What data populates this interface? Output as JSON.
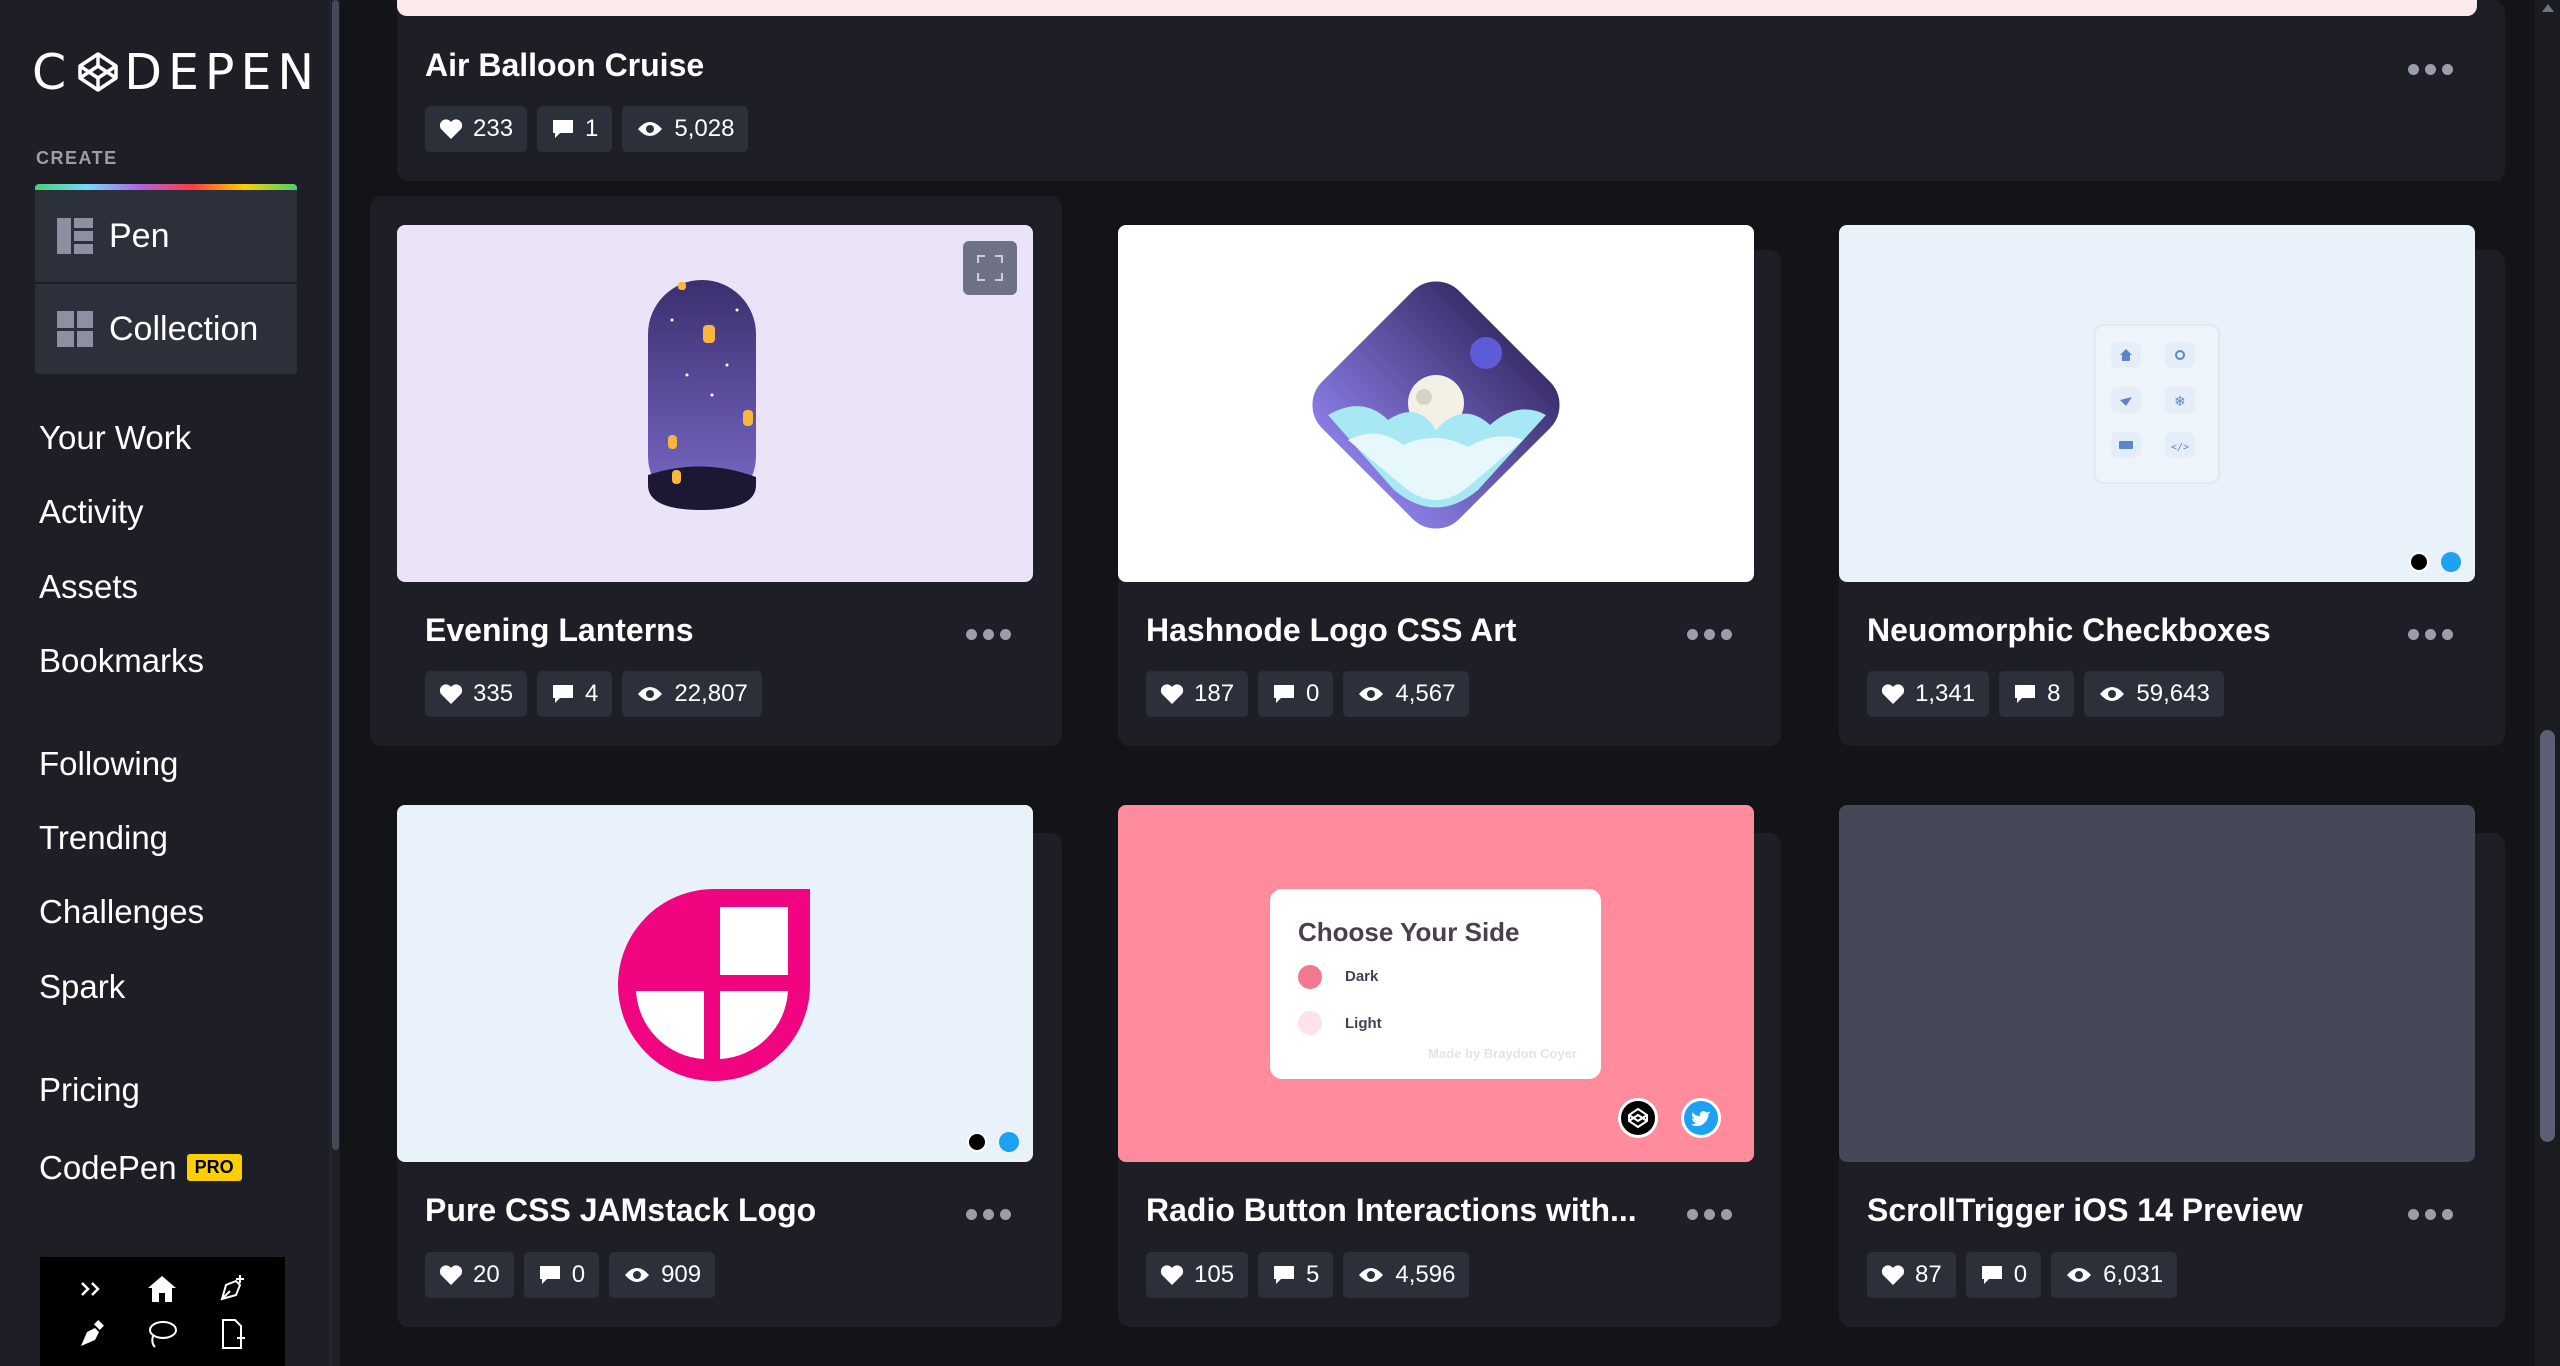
{
  "brand": {
    "logo_text_left": "C",
    "logo_text_right": "DEPEN"
  },
  "sidebar": {
    "create_label": "CREATE",
    "create_items": [
      {
        "label": "Pen",
        "icon": "pen-layout-icon"
      },
      {
        "label": "Collection",
        "icon": "collection-grid-icon"
      }
    ],
    "nav": [
      {
        "label": "Your Work"
      },
      {
        "label": "Activity"
      },
      {
        "label": "Assets"
      },
      {
        "label": "Bookmarks"
      },
      {
        "label": "Following"
      },
      {
        "label": "Trending"
      },
      {
        "label": "Challenges"
      },
      {
        "label": "Spark"
      },
      {
        "label": "Pricing"
      },
      {
        "label": "CodePen",
        "badge": "PRO"
      }
    ],
    "tools": [
      "collapse-icon",
      "home-icon",
      "new-pen-icon",
      "pen-tool-icon",
      "lasso-icon",
      "new-file-icon"
    ]
  },
  "cards": [
    {
      "title": "Air Balloon Cruise",
      "likes": "233",
      "comments": "1",
      "views": "5,028"
    },
    {
      "title": "Evening Lanterns",
      "likes": "335",
      "comments": "4",
      "views": "22,807"
    },
    {
      "title": "Hashnode Logo CSS Art",
      "likes": "187",
      "comments": "0",
      "views": "4,567"
    },
    {
      "title": "Neuomorphic Checkboxes",
      "likes": "1,341",
      "comments": "8",
      "views": "59,643"
    },
    {
      "title": "Pure CSS JAMstack Logo",
      "likes": "20",
      "comments": "0",
      "views": "909"
    },
    {
      "title": "Radio Button Interactions with...",
      "likes": "105",
      "comments": "5",
      "views": "4,596"
    },
    {
      "title": "ScrollTrigger iOS 14 Preview",
      "likes": "87",
      "comments": "0",
      "views": "6,031"
    }
  ],
  "radio_preview": {
    "heading": "Choose Your Side",
    "option_dark": "Dark",
    "option_light": "Light",
    "credit": "Made by Braydon Coyer"
  },
  "colors": {
    "accent_pink": "#ff8b9c",
    "jamstack_magenta": "#f0047f",
    "lavender_bg": "#ebe4f9",
    "neu_bg": "#e9f1fa"
  }
}
